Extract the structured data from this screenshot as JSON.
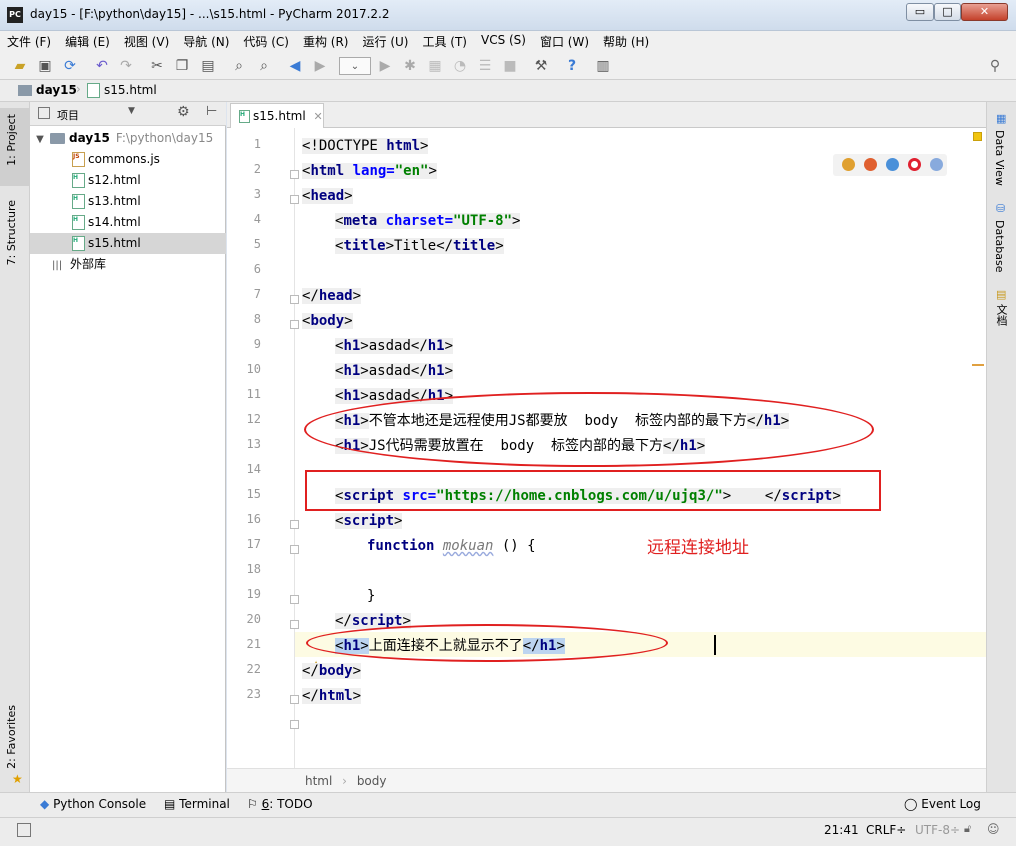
{
  "window": {
    "title": "day15 - [F:\\python\\day15] - ...\\s15.html - PyCharm 2017.2.2",
    "app_icon_text": "PC",
    "min_glyph": "▭",
    "max_glyph": "□",
    "close_glyph": "✕"
  },
  "menu": [
    "文件 (F)",
    "编辑 (E)",
    "视图 (V)",
    "导航 (N)",
    "代码 (C)",
    "重构 (R)",
    "运行 (U)",
    "工具 (T)",
    "VCS (S)",
    "窗口 (W)",
    "帮助 (H)"
  ],
  "toolbar_icons": [
    "open-icon",
    "save-icon",
    "sync-icon",
    "undo-icon",
    "redo-icon",
    "cut-icon",
    "copy-icon",
    "paste-icon",
    "find-icon",
    "replace-icon",
    "back-icon",
    "forward-icon",
    "run-config-dropdown",
    "run-icon",
    "debug-icon",
    "coverage-icon",
    "profile-icon",
    "concurrency-icon",
    "stop-icon",
    "settings-icon",
    "help-icon",
    "sdk-icon",
    "search-everywhere-icon"
  ],
  "breadcrumb": {
    "project": "day15",
    "file": "s15.html"
  },
  "left_tabs": {
    "project": "1: Project",
    "structure": "7: Structure",
    "favorites": "2: Favorites"
  },
  "project_panel": {
    "header": "项目",
    "root_name": "day15",
    "root_path": "F:\\python\\day15",
    "files": [
      {
        "name": "commons.js",
        "type": "JS"
      },
      {
        "name": "s12.html",
        "type": "H"
      },
      {
        "name": "s13.html",
        "type": "H"
      },
      {
        "name": "s14.html",
        "type": "H"
      },
      {
        "name": "s15.html",
        "type": "H"
      }
    ],
    "external_libs": "外部库"
  },
  "editor": {
    "tab_label": "s15.html",
    "line_numbers": [
      "1",
      "2",
      "3",
      "4",
      "5",
      "6",
      "7",
      "8",
      "9",
      "10",
      "11",
      "12",
      "13",
      "14",
      "15",
      "16",
      "17",
      "18",
      "19",
      "20",
      "21",
      "22",
      "23"
    ],
    "lines": {
      "l1": {
        "a": "<!DOCTYPE ",
        "b": "html",
        "c": ">"
      },
      "l2": {
        "a": "<",
        "b": "html ",
        "c": "lang=",
        "d": "\"en\"",
        "e": ">"
      },
      "l3": {
        "a": "<",
        "b": "head",
        "c": ">"
      },
      "l4": {
        "a": "<",
        "b": "meta ",
        "c": "charset=",
        "d": "\"UTF-8\"",
        "e": ">"
      },
      "l5": {
        "a": "<",
        "b": "title",
        "c": ">",
        "d": "Title",
        "e": "</",
        "f": "title",
        "g": ">"
      },
      "l7": {
        "a": "</",
        "b": "head",
        "c": ">"
      },
      "l8": {
        "a": "<",
        "b": "body",
        "c": ">"
      },
      "l9": {
        "a": "<",
        "b": "h1",
        "c": ">",
        "d": "asdad",
        "e": "</",
        "f": "h1",
        "g": ">"
      },
      "l10": {
        "a": "<",
        "b": "h1",
        "c": ">",
        "d": "asdad",
        "e": "</",
        "f": "h1",
        "g": ">"
      },
      "l11": {
        "a": "<",
        "b": "h1",
        "c": ">",
        "d": "asdad",
        "e": "</",
        "f": "h1",
        "g": ">"
      },
      "l12": {
        "a": "<",
        "b": "h1",
        "c": ">",
        "d": "不管本地还是远程使用JS都要放  body  标签内部的最下方",
        "e": "</",
        "f": "h1",
        "g": ">"
      },
      "l13": {
        "a": "<",
        "b": "h1",
        "c": ">",
        "d": "JS代码需要放置在  body  标签内部的最下方",
        "e": "</",
        "f": "h1",
        "g": ">"
      },
      "l15": {
        "a": "<",
        "b": "script ",
        "c": "src=",
        "d": "\"https://home.cnblogs.com/u/ujq3/\"",
        "e": ">",
        "f": "    </",
        "g": "script",
        "h": ">"
      },
      "l16": {
        "a": "<",
        "b": "script",
        "c": ">"
      },
      "l17": {
        "a": "function ",
        "b": "mokuan",
        "c": " () {"
      },
      "l19": {
        "a": "}"
      },
      "l20": {
        "a": "</",
        "b": "script",
        "c": ">"
      },
      "l21": {
        "a": "<",
        "b": "h1",
        "c": ">",
        "d": "上面连接不上就显示不了",
        "e": "</",
        "f": "h1",
        "g": ">"
      },
      "l22": {
        "a": "</",
        "b": "body",
        "c": ">"
      },
      "l23": {
        "a": "</",
        "b": "html",
        "c": ">"
      }
    },
    "breadcrumb_path": {
      "a": "html",
      "sep": "›",
      "b": "body"
    }
  },
  "annotation": {
    "label": "远程连接地址",
    "color": "#e02020"
  },
  "right_tabs": {
    "dataview": "Data View",
    "database": "Database",
    "docs": "文档"
  },
  "bottom_tabs": {
    "python_console": "Python Console",
    "terminal": "Terminal",
    "todo_num": "6",
    "todo_label": ": TODO",
    "event_log": "Event Log"
  },
  "status": {
    "position": "21:41",
    "line_sep": "CRLF÷",
    "encoding": "UTF-8÷"
  }
}
